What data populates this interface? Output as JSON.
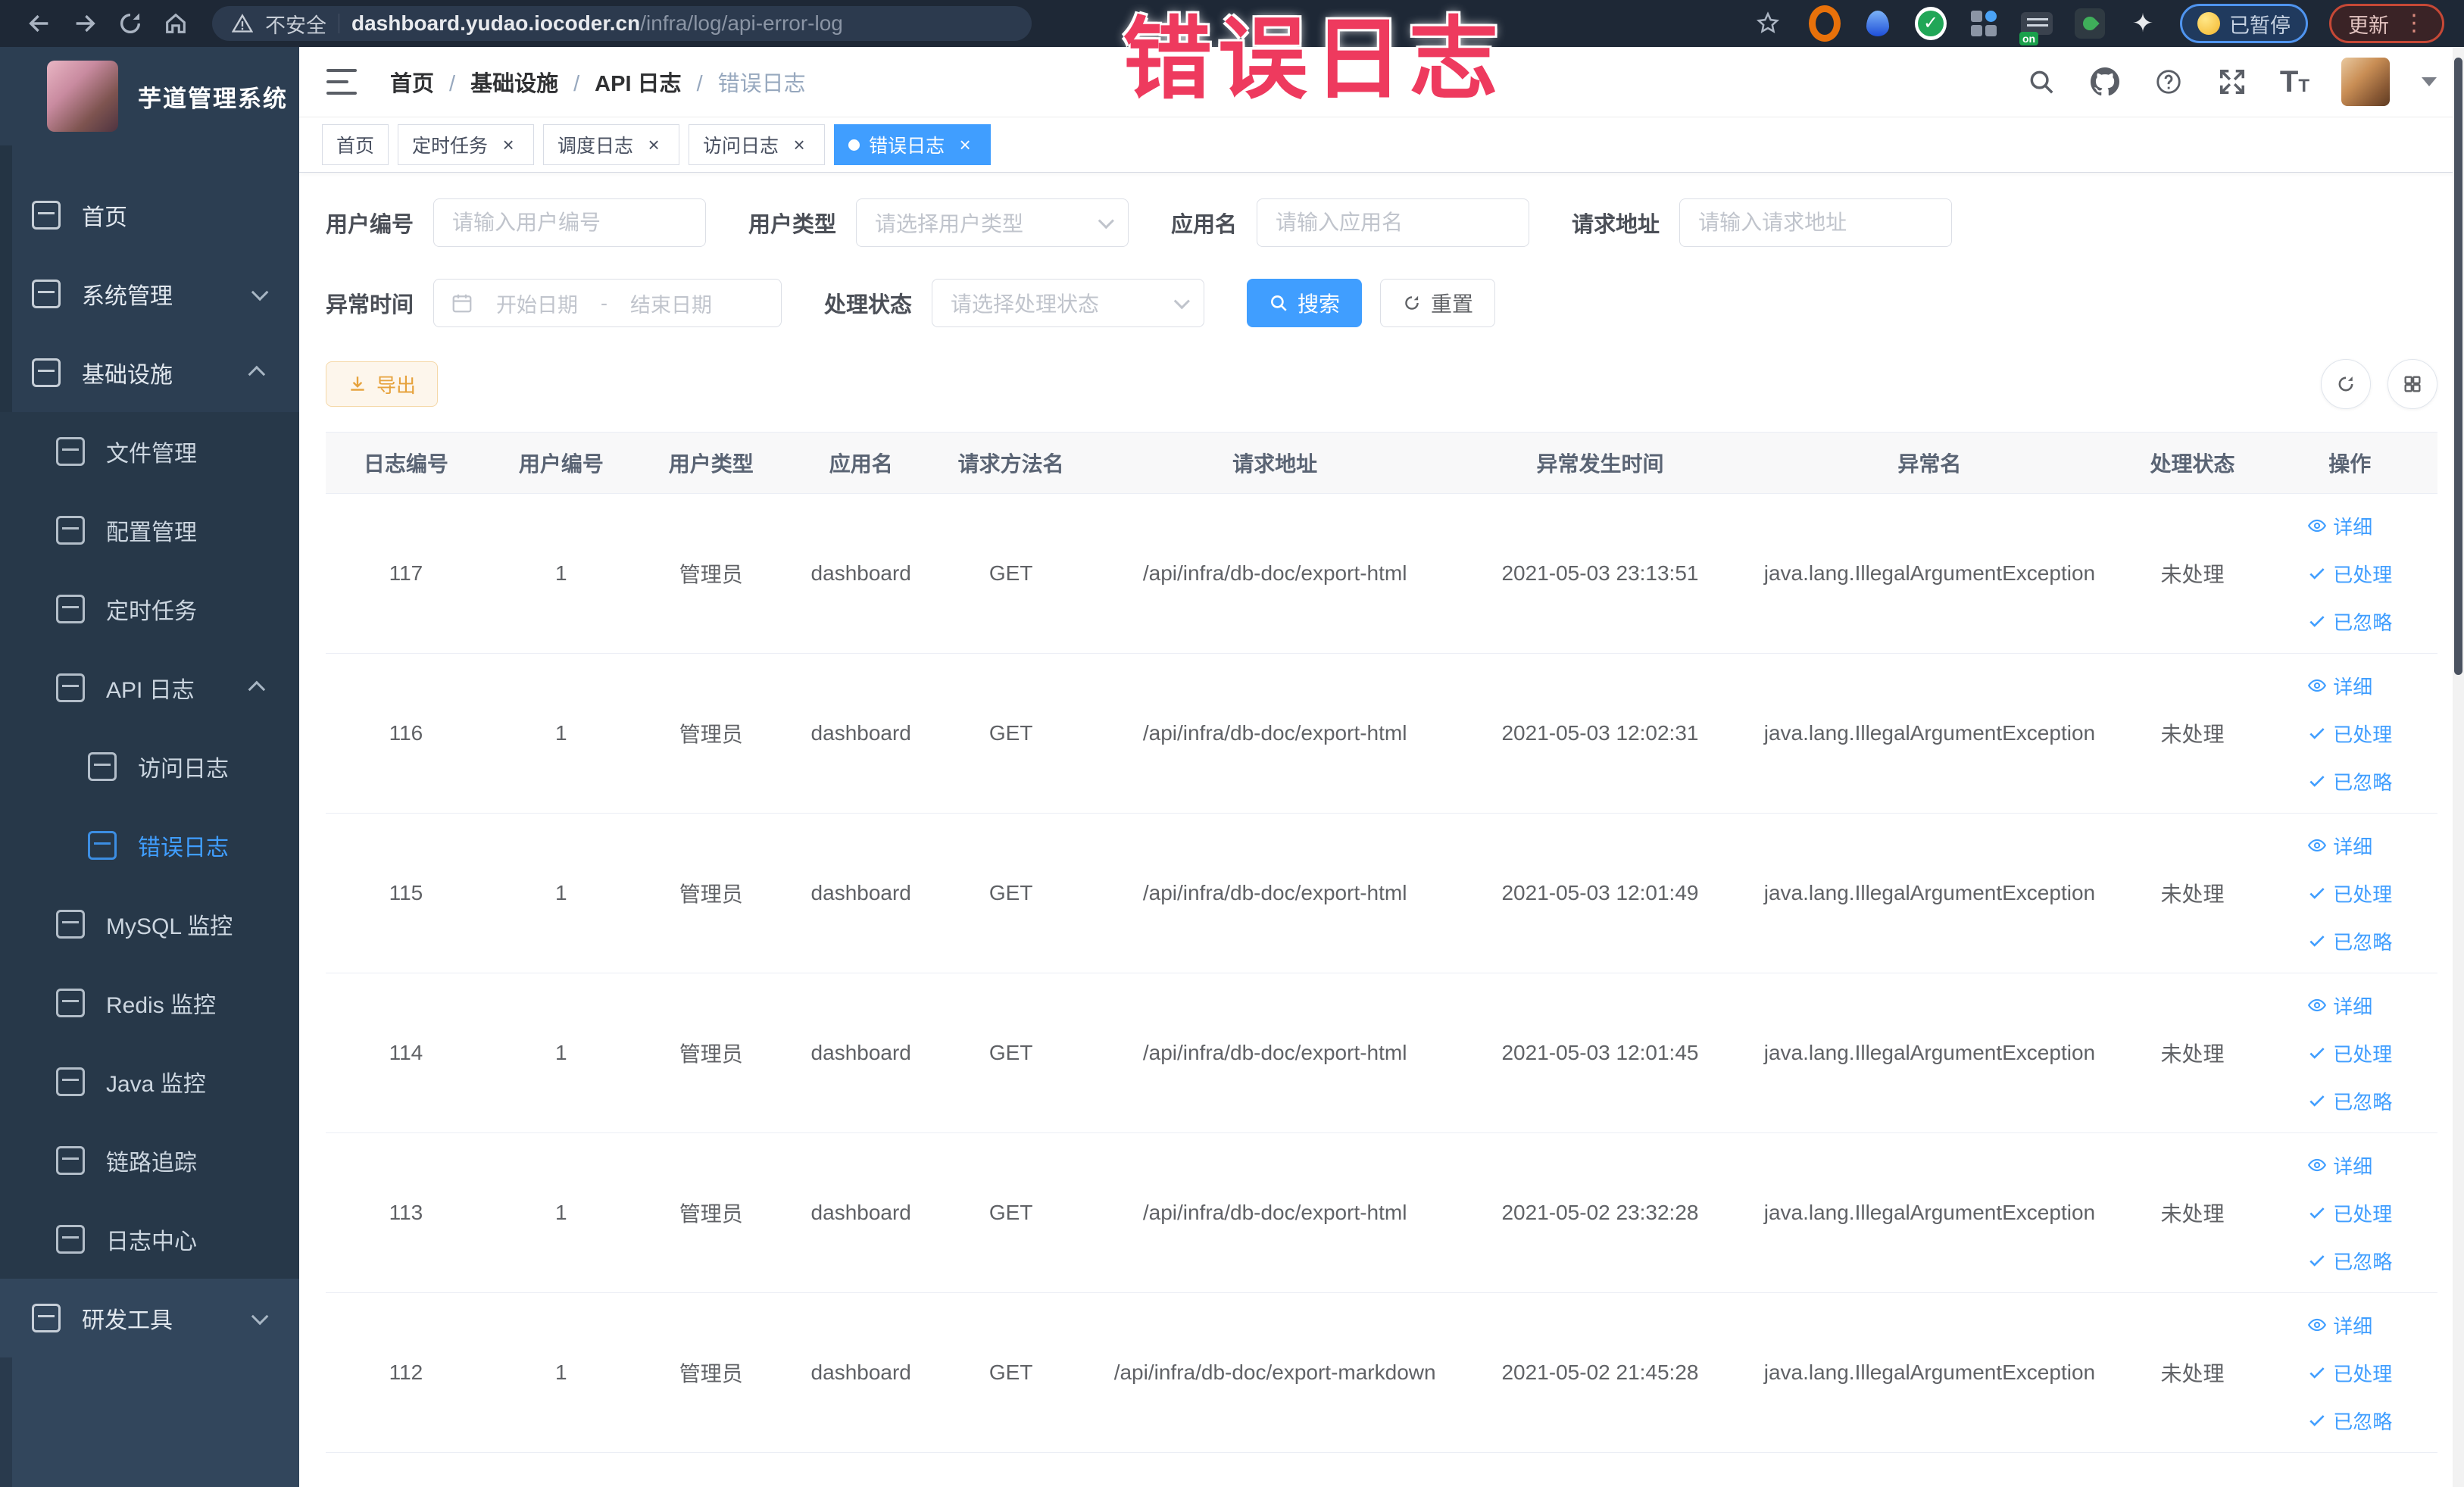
{
  "browser": {
    "security": "不安全",
    "url_host": "dashboard.yudao.iocoder.cn",
    "url_path": "/infra/log/api-error-log",
    "switch_badge": "on",
    "paused_label": "已暂停",
    "update_label": "更新"
  },
  "overlay": {
    "text": "错误日志"
  },
  "ui": {
    "close_glyph": "×",
    "kebab_glyph": "⋮",
    "star_glyph": "✦"
  },
  "sidebar": {
    "app_title": "芋道管理系统",
    "items": [
      {
        "label": "首页",
        "icon": "home",
        "level": 0,
        "section": "top"
      },
      {
        "label": "系统管理",
        "icon": "gear",
        "level": 0,
        "section": "top",
        "chevron": "down"
      },
      {
        "label": "基础设施",
        "icon": "infrastructure",
        "level": 0,
        "section": "top",
        "chevron": "up"
      },
      {
        "label": "文件管理",
        "icon": "cloud",
        "level": 1,
        "section": "sub"
      },
      {
        "label": "配置管理",
        "icon": "edit",
        "level": 1,
        "section": "sub"
      },
      {
        "label": "定时任务",
        "icon": "timer",
        "level": 1,
        "section": "sub"
      },
      {
        "label": "API 日志",
        "icon": "log",
        "level": 1,
        "section": "sub",
        "chevron": "up"
      },
      {
        "label": "访问日志",
        "icon": "log",
        "level": 2,
        "section": "sub"
      },
      {
        "label": "错误日志",
        "icon": "log",
        "level": 2,
        "section": "sub",
        "active": true
      },
      {
        "label": "MySQL 监控",
        "icon": "mysql",
        "level": 1,
        "section": "sub"
      },
      {
        "label": "Redis 监控",
        "icon": "redis",
        "level": 1,
        "section": "sub"
      },
      {
        "label": "Java 监控",
        "icon": "java",
        "level": 1,
        "section": "sub"
      },
      {
        "label": "链路追踪",
        "icon": "trace",
        "level": 1,
        "section": "sub"
      },
      {
        "label": "日志中心",
        "icon": "log-center",
        "level": 1,
        "section": "sub"
      },
      {
        "label": "研发工具",
        "icon": "tools",
        "level": 0,
        "section": "bottom",
        "chevron": "down"
      }
    ]
  },
  "header": {
    "breadcrumb": [
      {
        "label": "首页"
      },
      {
        "label": "基础设施"
      },
      {
        "label": "API 日志"
      },
      {
        "label": "错误日志",
        "current": true
      }
    ]
  },
  "tabs": [
    {
      "label": "首页"
    },
    {
      "label": "定时任务",
      "closable": true
    },
    {
      "label": "调度日志",
      "closable": true
    },
    {
      "label": "访问日志",
      "closable": true
    },
    {
      "label": "错误日志",
      "closable": true,
      "active": true
    }
  ],
  "filters": {
    "user_id_label": "用户编号",
    "user_id_placeholder": "请输入用户编号",
    "user_type_label": "用户类型",
    "user_type_placeholder": "请选择用户类型",
    "app_name_label": "应用名",
    "app_name_placeholder": "请输入应用名",
    "request_url_label": "请求地址",
    "request_url_placeholder": "请输入请求地址",
    "exception_time_label": "异常时间",
    "date_start_placeholder": "开始日期",
    "date_separator": "-",
    "date_end_placeholder": "结束日期",
    "process_status_label": "处理状态",
    "process_status_placeholder": "请选择处理状态",
    "search_label": "搜索",
    "reset_label": "重置"
  },
  "toolbar": {
    "export_label": "导出"
  },
  "table": {
    "headers": [
      {
        "label": "日志编号",
        "col": "c0"
      },
      {
        "label": "用户编号",
        "col": "c1"
      },
      {
        "label": "用户类型",
        "col": "c2"
      },
      {
        "label": "应用名",
        "col": "c3"
      },
      {
        "label": "请求方法名",
        "col": "c4"
      },
      {
        "label": "请求地址",
        "col": "c5"
      },
      {
        "label": "异常发生时间",
        "col": "c6"
      },
      {
        "label": "异常名",
        "col": "c7"
      },
      {
        "label": "处理状态",
        "col": "c8"
      },
      {
        "label": "操作",
        "col": "c9"
      }
    ],
    "actions": {
      "detail": "详细",
      "processed": "已处理",
      "ignored": "已忽略"
    },
    "rows": [
      {
        "id": "117",
        "user_id": "1",
        "user_type": "管理员",
        "app": "dashboard",
        "method": "GET",
        "url": "/api/infra/db-doc/export-html",
        "time": "2021-05-03 23:13:51",
        "exception": "java.lang.IllegalArgumentException",
        "status": "未处理"
      },
      {
        "id": "116",
        "user_id": "1",
        "user_type": "管理员",
        "app": "dashboard",
        "method": "GET",
        "url": "/api/infra/db-doc/export-html",
        "time": "2021-05-03 12:02:31",
        "exception": "java.lang.IllegalArgumentException",
        "status": "未处理"
      },
      {
        "id": "115",
        "user_id": "1",
        "user_type": "管理员",
        "app": "dashboard",
        "method": "GET",
        "url": "/api/infra/db-doc/export-html",
        "time": "2021-05-03 12:01:49",
        "exception": "java.lang.IllegalArgumentException",
        "status": "未处理"
      },
      {
        "id": "114",
        "user_id": "1",
        "user_type": "管理员",
        "app": "dashboard",
        "method": "GET",
        "url": "/api/infra/db-doc/export-html",
        "time": "2021-05-03 12:01:45",
        "exception": "java.lang.IllegalArgumentException",
        "status": "未处理"
      },
      {
        "id": "113",
        "user_id": "1",
        "user_type": "管理员",
        "app": "dashboard",
        "method": "GET",
        "url": "/api/infra/db-doc/export-html",
        "time": "2021-05-02 23:32:28",
        "exception": "java.lang.IllegalArgumentException",
        "status": "未处理"
      },
      {
        "id": "112",
        "user_id": "1",
        "user_type": "管理员",
        "app": "dashboard",
        "method": "GET",
        "url": "/api/infra/db-doc/export-markdown",
        "time": "2021-05-02 21:45:28",
        "exception": "java.lang.IllegalArgumentException",
        "status": "未处理"
      }
    ]
  }
}
